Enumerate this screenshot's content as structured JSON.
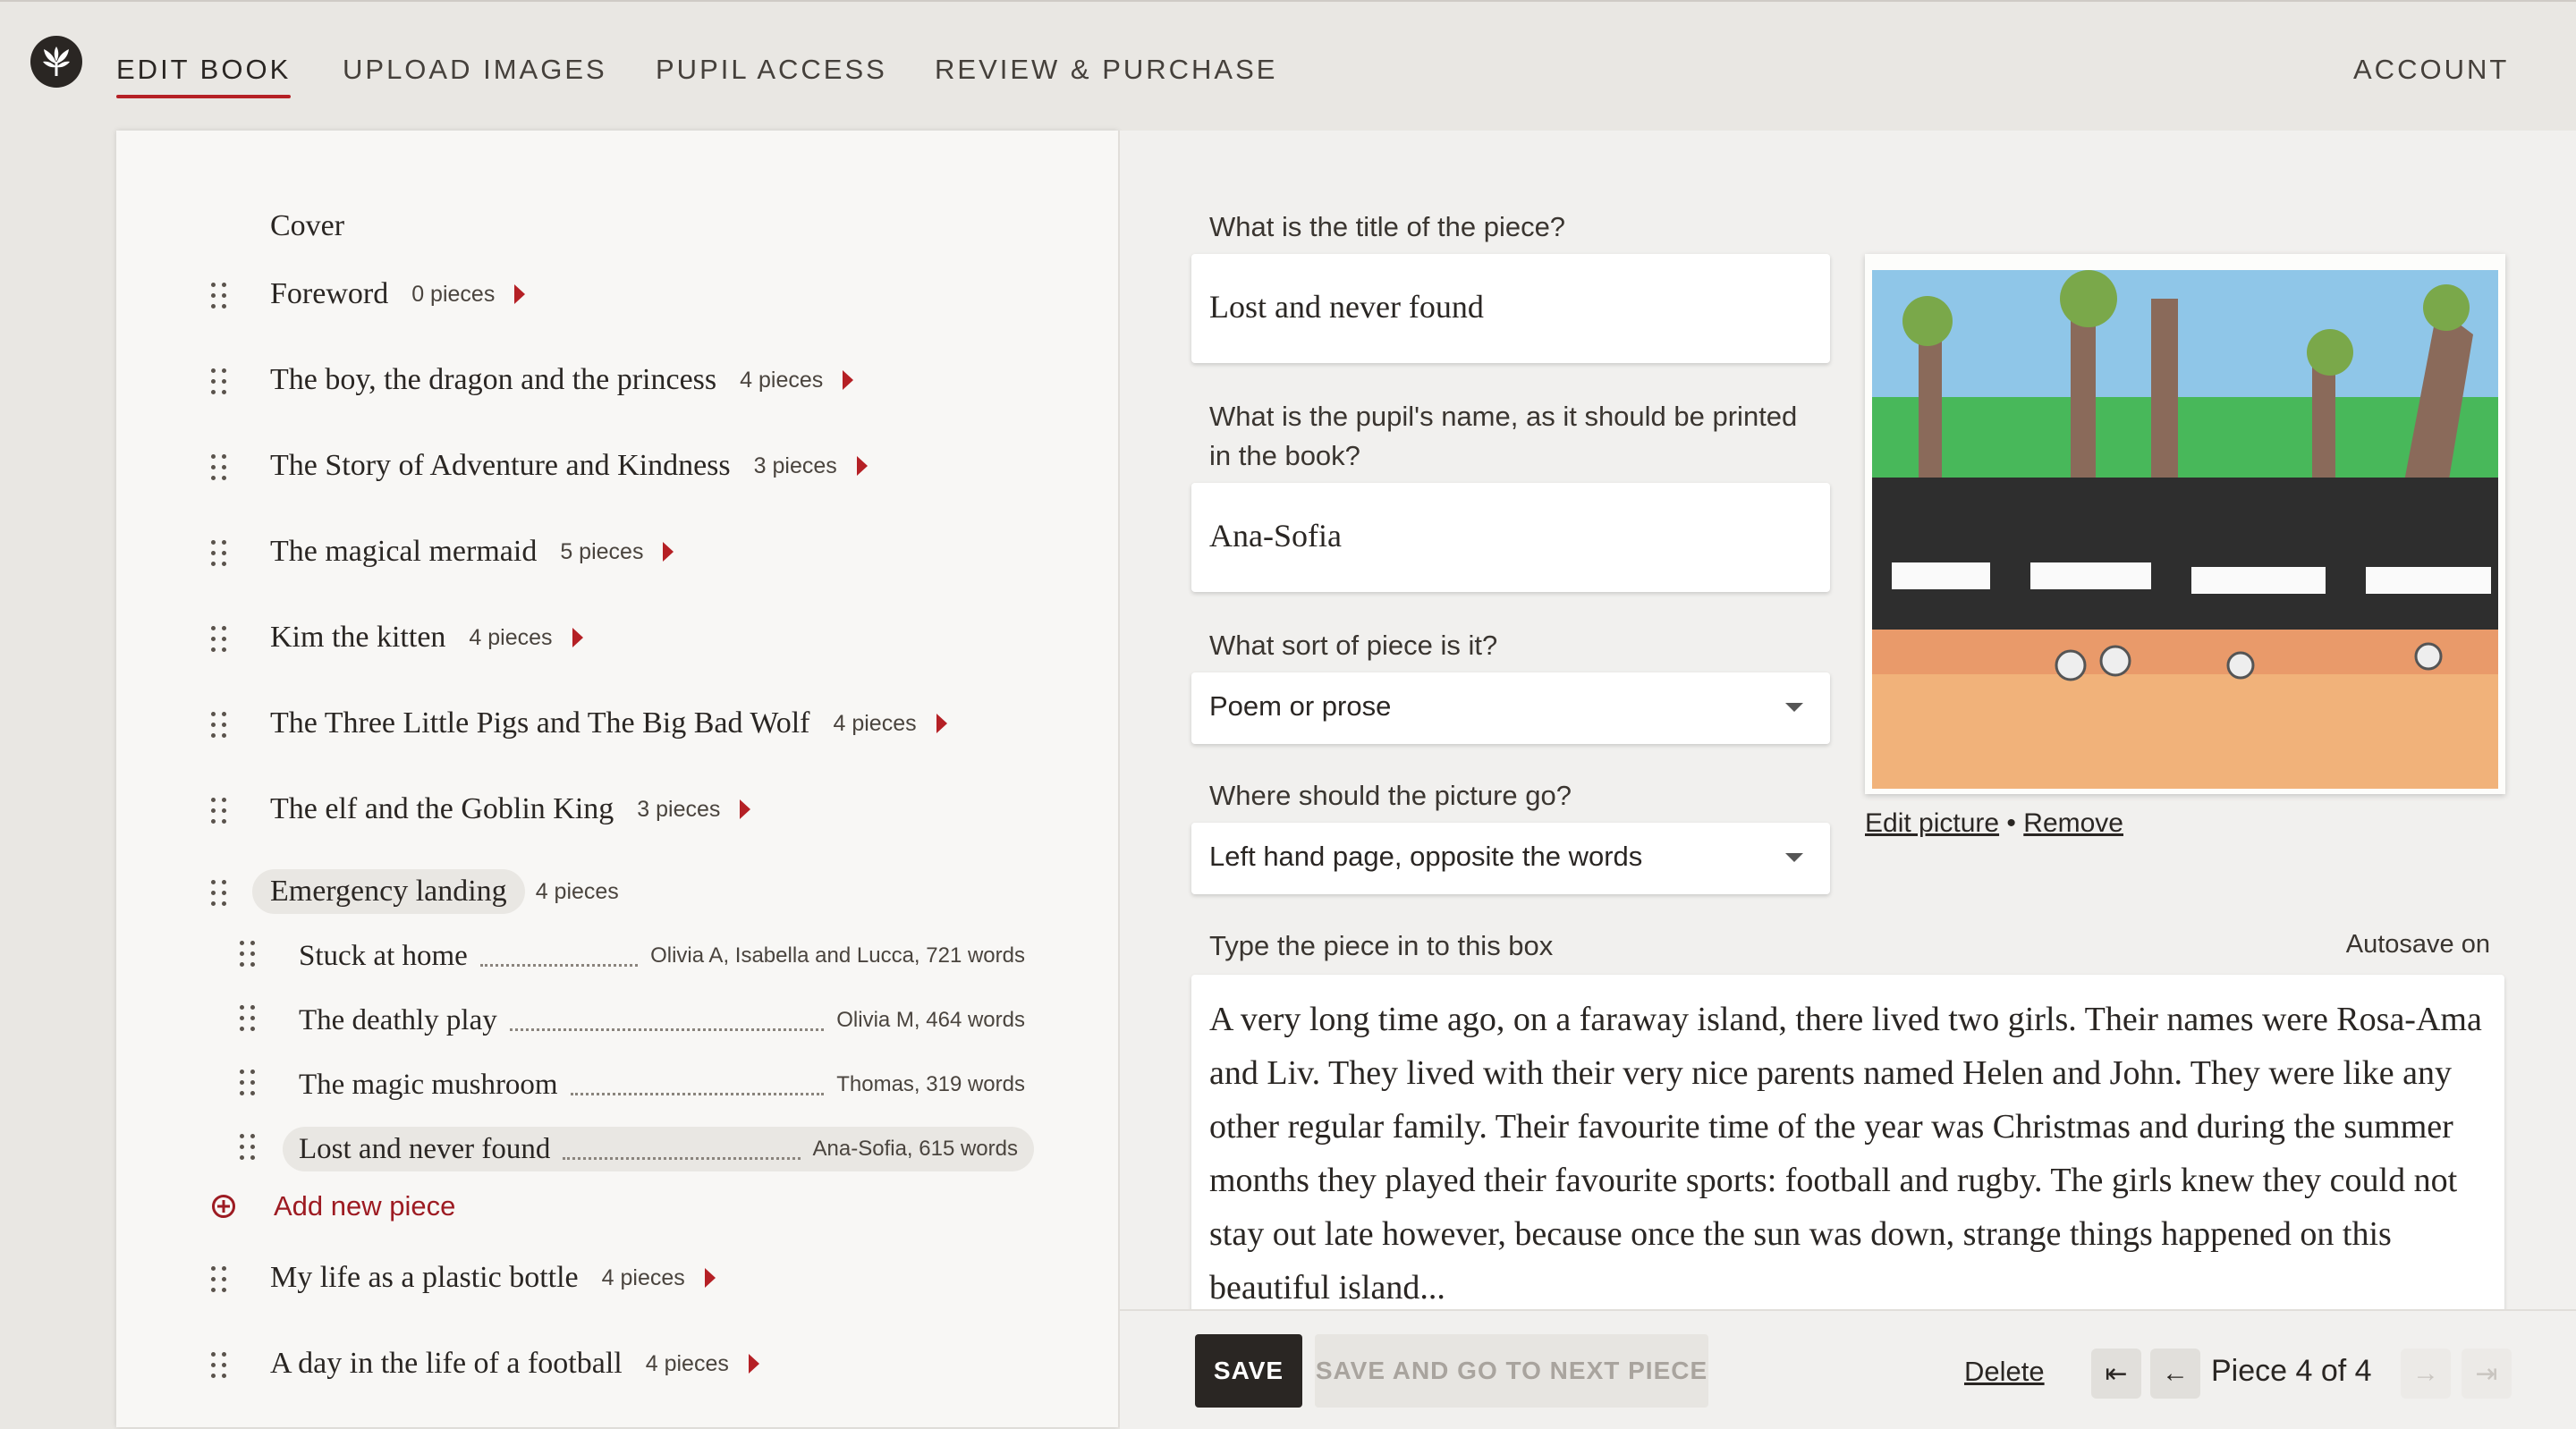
{
  "nav": {
    "items": [
      "EDIT BOOK",
      "UPLOAD IMAGES",
      "PUPIL ACCESS",
      "REVIEW & PURCHASE"
    ],
    "account": "ACCOUNT",
    "active_index": 0
  },
  "outline": {
    "cover": "Cover",
    "chapters": [
      {
        "title": "Foreword",
        "count": "0 pieces"
      },
      {
        "title": "The boy, the dragon and the princess",
        "count": "4 pieces"
      },
      {
        "title": "The Story of Adventure and Kindness",
        "count": "3 pieces"
      },
      {
        "title": "The magical mermaid",
        "count": "5 pieces"
      },
      {
        "title": "Kim the kitten",
        "count": "4 pieces"
      },
      {
        "title": "The Three Little Pigs and The Big Bad Wolf",
        "count": "4 pieces"
      },
      {
        "title": "The elf and the Goblin King",
        "count": "3 pieces"
      },
      {
        "title": "Emergency landing",
        "count": "4 pieces"
      },
      {
        "title": "My life as a plastic bottle",
        "count": "4 pieces"
      },
      {
        "title": "A day in the life of a football",
        "count": "4 pieces"
      }
    ],
    "expanded_chapter_pieces": [
      {
        "title": "Stuck at home",
        "meta": "Olivia A, Isabella and Lucca, 721 words"
      },
      {
        "title": "The deathly play",
        "meta": "Olivia M, 464 words"
      },
      {
        "title": "The magic mushroom",
        "meta": "Thomas, 319 words"
      },
      {
        "title": "Lost and never found",
        "meta": "Ana-Sofia, 615 words"
      }
    ],
    "add_piece": "Add new piece"
  },
  "form": {
    "title_label": "What is the title of the piece?",
    "title_value": "Lost and never found",
    "pupil_label": "What is the pupil's name, as it should be printed in the book?",
    "pupil_value": "Ana-Sofia",
    "sort_label": "What sort of piece is it?",
    "sort_value": "Poem or prose",
    "picture_label": "Where should the picture go?",
    "picture_value": "Left hand page, opposite the words",
    "edit_picture": "Edit picture",
    "bullet": "•",
    "remove": "Remove",
    "body_label": "Type the piece in to this box",
    "autosave": "Autosave on",
    "body_text": "A very long time ago, on a faraway island, there lived two girls. Their names were Rosa-Ama and Liv. They lived with their very nice parents named Helen and John. They were like any other regular family. Their favourite time of the year was Christmas and during the summer months they played their favourite sports: football and rugby. The girls knew they could not stay out late however, because once the sun was down, strange things happened on this beautiful island..."
  },
  "footer": {
    "save": "SAVE",
    "save_next": "SAVE AND GO TO NEXT PIECE",
    "delete": "Delete",
    "first_icon": "⇤",
    "prev_icon": "←",
    "next_icon": "→",
    "last_icon": "⇥",
    "piece_count": "Piece 4 of 4"
  },
  "colors": {
    "accent": "#b52025",
    "dark": "#2a2623",
    "background": "#e9e7e3"
  }
}
